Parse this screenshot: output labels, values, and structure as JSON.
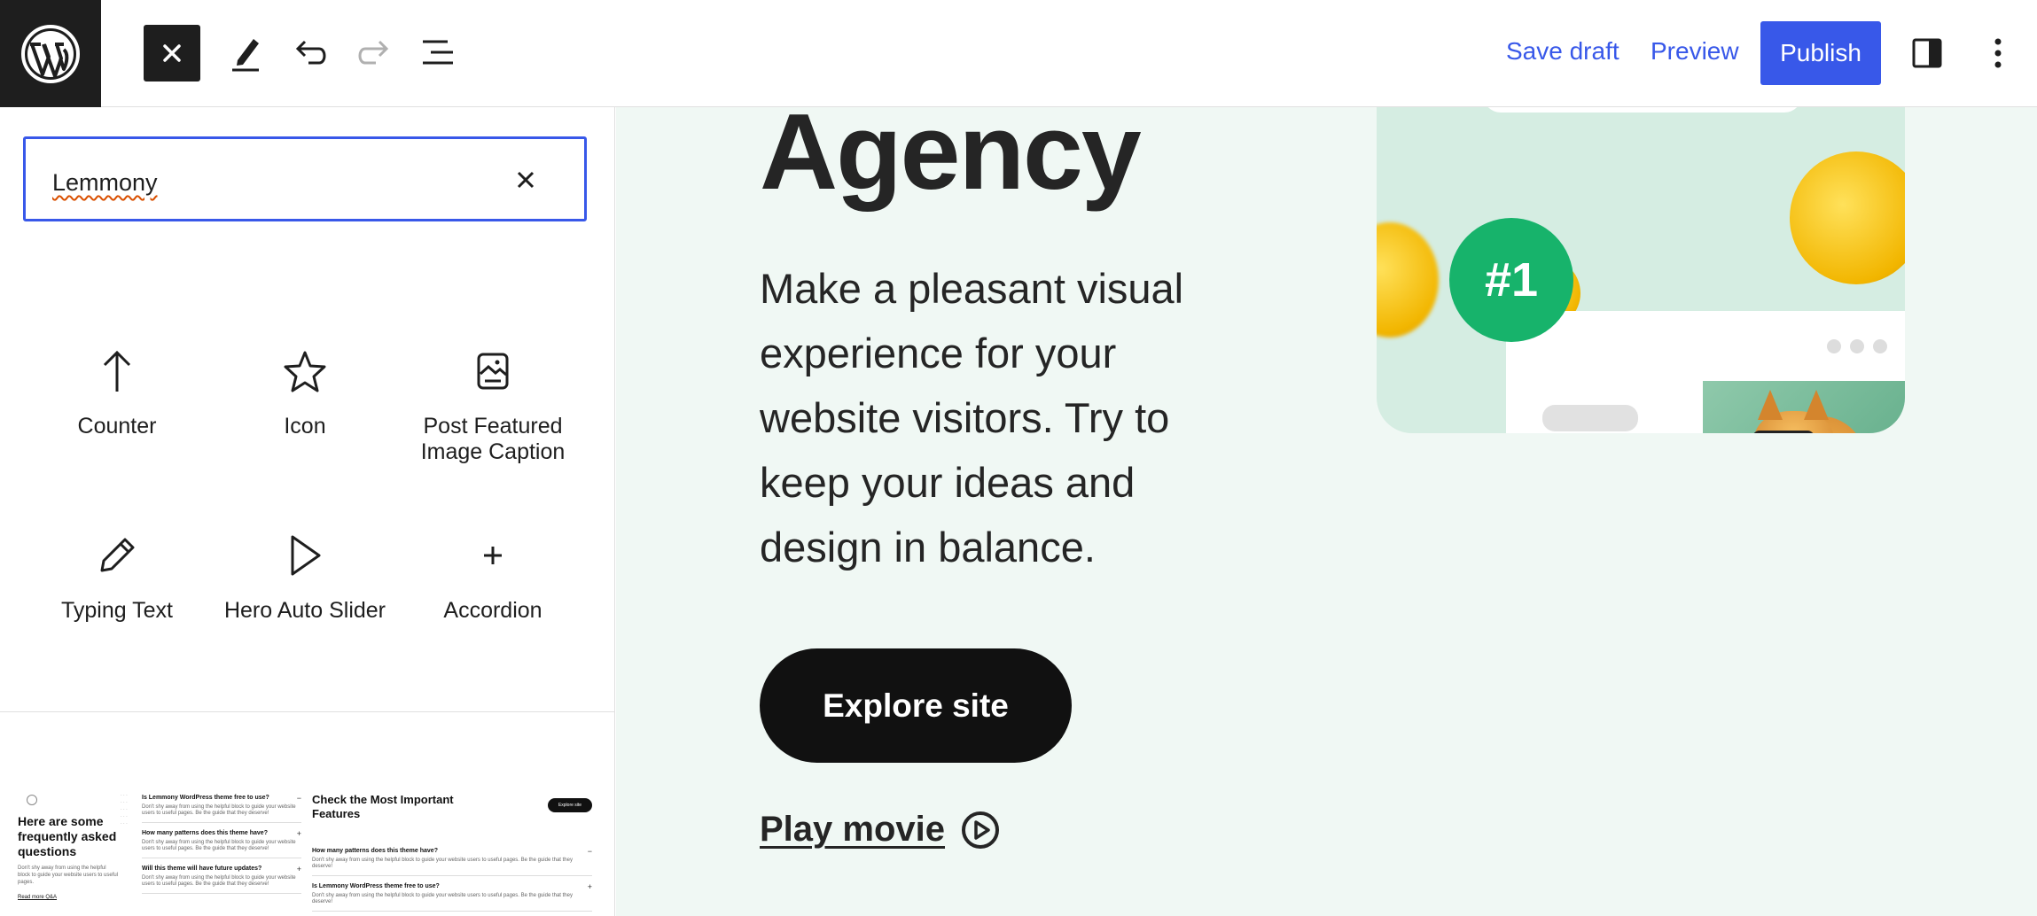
{
  "toolbar": {
    "logo_icon": "wordpress-logo",
    "close_icon": "close-icon",
    "tools_icon": "pencil-icon",
    "undo_icon": "undo-icon",
    "redo_icon": "redo-icon",
    "outline_icon": "list-view-icon",
    "save_draft_label": "Save draft",
    "preview_label": "Preview",
    "publish_label": "Publish",
    "settings_icon": "sidebar-toggle-icon",
    "options_icon": "more-vertical-icon",
    "accent_color": "#3858e9"
  },
  "inserter": {
    "search_value": "Lemmony",
    "blocks": [
      {
        "label": "Counter",
        "icon": "arrow-up-icon"
      },
      {
        "label": "Icon",
        "icon": "star-icon"
      },
      {
        "label": "Post Featured Image Caption",
        "icon": "image-caption-icon"
      },
      {
        "label": "Typing Text",
        "icon": "pencil-icon"
      },
      {
        "label": "Hero Auto Slider",
        "icon": "play-icon"
      },
      {
        "label": "Accordion",
        "icon": "plus-icon"
      }
    ],
    "pattern_preview": {
      "heading": "Here are some frequently asked questions",
      "intro": "Don't shy away from using the helpful block to guide your website users to useful pages.",
      "read_more": "Read more Q&A",
      "faq": [
        {
          "q": "Is Lemmony WordPress theme free to use?",
          "a": "Don't shy away from using the helpful block to guide your website users to useful pages. Be the guide that they deserve!",
          "marker": "−"
        },
        {
          "q": "How many patterns does this theme have?",
          "a": "Don't shy away from using the helpful block to guide your website users to useful pages. Be the guide that they deserve!",
          "marker": "+"
        },
        {
          "q": "Will this theme will have future updates?",
          "a": "Don't shy away from using the helpful block to guide your website users to useful pages. Be the guide that they deserve!",
          "marker": "+"
        }
      ],
      "features_heading": "Check the Most Important Features",
      "features_button": "Explore site",
      "features": [
        {
          "q": "How many patterns does this theme have?",
          "a": "Don't shy away from using the helpful block to guide your website users to useful pages. Be the guide that they deserve!",
          "marker": "−"
        },
        {
          "q": "Is Lemmony WordPress theme free to use?",
          "a": "Don't shy away from using the helpful block to guide your website users to useful pages. Be the guide that they deserve!",
          "marker": "+"
        }
      ]
    }
  },
  "canvas": {
    "title": "Agency",
    "text": "Make a pleasant visual experience for your website visitors. Try to keep your ideas and design in balance.",
    "explore_label": "Explore site",
    "play_label": "Play movie",
    "badge": "#1",
    "background": "#f0f8f4",
    "brand_green": "#17b36b"
  }
}
